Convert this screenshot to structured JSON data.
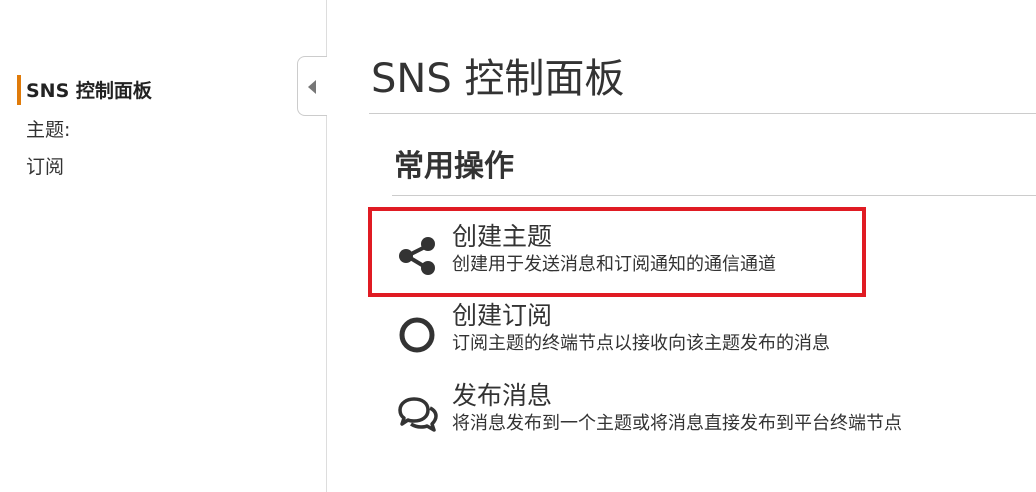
{
  "sidebar": {
    "items": [
      {
        "label": "SNS 控制面板",
        "active": true
      },
      {
        "label": "主题:",
        "active": false
      },
      {
        "label": "订阅",
        "active": false
      }
    ],
    "active_marker_color": "#e07b0a",
    "collapse_icon": "chevron-left-icon"
  },
  "main": {
    "title": "SNS 控制面板",
    "section_title": "常用操作",
    "actions": [
      {
        "title": "创建主题",
        "description": "创建用于发送消息和订阅通知的通信通道",
        "icon": "share-icon",
        "highlighted": true
      },
      {
        "title": "创建订阅",
        "description": "订阅主题的终端节点以接收向该主题发布的消息",
        "icon": "circle-icon",
        "highlighted": false
      },
      {
        "title": "发布消息",
        "description": "将消息发布到一个主题或将消息直接发布到平台终端节点",
        "icon": "chat-bubbles-icon",
        "highlighted": false
      }
    ],
    "highlight_color": "#e01b23"
  }
}
